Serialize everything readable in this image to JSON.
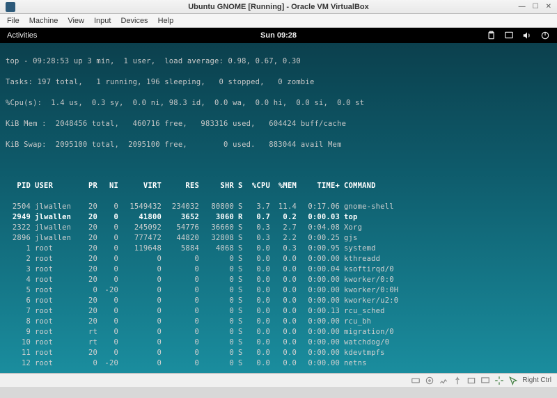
{
  "host": {
    "title": "Ubuntu GNOME [Running] - Oracle VM VirtualBox",
    "menu": [
      "File",
      "Machine",
      "View",
      "Input",
      "Devices",
      "Help"
    ],
    "win_min": "—",
    "win_max": "☐",
    "win_close": "✕",
    "status_hint": "Right Ctrl"
  },
  "gnome": {
    "activities": "Activities",
    "clock": "Sun 09:28"
  },
  "top": {
    "line1": "top - 09:28:53 up 3 min,  1 user,  load average: 0.98, 0.67, 0.30",
    "line2": "Tasks: 197 total,   1 running, 196 sleeping,   0 stopped,   0 zombie",
    "line3": "%Cpu(s):  1.4 us,  0.3 sy,  0.0 ni, 98.3 id,  0.0 wa,  0.0 hi,  0.0 si,  0.0 st",
    "line4": "KiB Mem :  2048456 total,   460716 free,   983316 used,   604424 buff/cache",
    "line5": "KiB Swap:  2095100 total,  2095100 free,        0 used.   883044 avail Mem",
    "cols": [
      "PID",
      "USER",
      "PR",
      "NI",
      "VIRT",
      "RES",
      "SHR",
      "S",
      "%CPU",
      "%MEM",
      "TIME+",
      "COMMAND"
    ],
    "rows": [
      {
        "pid": "2504",
        "user": "jlwallen",
        "pr": "20",
        "ni": "0",
        "virt": "1549432",
        "res": "234032",
        "shr": "80800",
        "s": "S",
        "cpu": "3.7",
        "mem": "11.4",
        "time": "0:17.06",
        "cmd": "gnome-shell",
        "bold": false
      },
      {
        "pid": "2949",
        "user": "jlwallen",
        "pr": "20",
        "ni": "0",
        "virt": "41800",
        "res": "3652",
        "shr": "3060",
        "s": "R",
        "cpu": "0.7",
        "mem": "0.2",
        "time": "0:00.03",
        "cmd": "top",
        "bold": true
      },
      {
        "pid": "2322",
        "user": "jlwallen",
        "pr": "20",
        "ni": "0",
        "virt": "245092",
        "res": "54776",
        "shr": "36660",
        "s": "S",
        "cpu": "0.3",
        "mem": "2.7",
        "time": "0:04.08",
        "cmd": "Xorg",
        "bold": false
      },
      {
        "pid": "2896",
        "user": "jlwallen",
        "pr": "20",
        "ni": "0",
        "virt": "777472",
        "res": "44820",
        "shr": "32808",
        "s": "S",
        "cpu": "0.3",
        "mem": "2.2",
        "time": "0:00.25",
        "cmd": "gjs",
        "bold": false
      },
      {
        "pid": "1",
        "user": "root",
        "pr": "20",
        "ni": "0",
        "virt": "119648",
        "res": "5884",
        "shr": "4068",
        "s": "S",
        "cpu": "0.0",
        "mem": "0.3",
        "time": "0:00.95",
        "cmd": "systemd",
        "bold": false
      },
      {
        "pid": "2",
        "user": "root",
        "pr": "20",
        "ni": "0",
        "virt": "0",
        "res": "0",
        "shr": "0",
        "s": "S",
        "cpu": "0.0",
        "mem": "0.0",
        "time": "0:00.00",
        "cmd": "kthreadd",
        "bold": false
      },
      {
        "pid": "3",
        "user": "root",
        "pr": "20",
        "ni": "0",
        "virt": "0",
        "res": "0",
        "shr": "0",
        "s": "S",
        "cpu": "0.0",
        "mem": "0.0",
        "time": "0:00.04",
        "cmd": "ksoftirqd/0",
        "bold": false
      },
      {
        "pid": "4",
        "user": "root",
        "pr": "20",
        "ni": "0",
        "virt": "0",
        "res": "0",
        "shr": "0",
        "s": "S",
        "cpu": "0.0",
        "mem": "0.0",
        "time": "0:00.00",
        "cmd": "kworker/0:0",
        "bold": false
      },
      {
        "pid": "5",
        "user": "root",
        "pr": "0",
        "ni": "-20",
        "virt": "0",
        "res": "0",
        "shr": "0",
        "s": "S",
        "cpu": "0.0",
        "mem": "0.0",
        "time": "0:00.00",
        "cmd": "kworker/0:0H",
        "bold": false
      },
      {
        "pid": "6",
        "user": "root",
        "pr": "20",
        "ni": "0",
        "virt": "0",
        "res": "0",
        "shr": "0",
        "s": "S",
        "cpu": "0.0",
        "mem": "0.0",
        "time": "0:00.00",
        "cmd": "kworker/u2:0",
        "bold": false
      },
      {
        "pid": "7",
        "user": "root",
        "pr": "20",
        "ni": "0",
        "virt": "0",
        "res": "0",
        "shr": "0",
        "s": "S",
        "cpu": "0.0",
        "mem": "0.0",
        "time": "0:00.13",
        "cmd": "rcu_sched",
        "bold": false
      },
      {
        "pid": "8",
        "user": "root",
        "pr": "20",
        "ni": "0",
        "virt": "0",
        "res": "0",
        "shr": "0",
        "s": "S",
        "cpu": "0.0",
        "mem": "0.0",
        "time": "0:00.00",
        "cmd": "rcu_bh",
        "bold": false
      },
      {
        "pid": "9",
        "user": "root",
        "pr": "rt",
        "ni": "0",
        "virt": "0",
        "res": "0",
        "shr": "0",
        "s": "S",
        "cpu": "0.0",
        "mem": "0.0",
        "time": "0:00.00",
        "cmd": "migration/0",
        "bold": false
      },
      {
        "pid": "10",
        "user": "root",
        "pr": "rt",
        "ni": "0",
        "virt": "0",
        "res": "0",
        "shr": "0",
        "s": "S",
        "cpu": "0.0",
        "mem": "0.0",
        "time": "0:00.00",
        "cmd": "watchdog/0",
        "bold": false
      },
      {
        "pid": "11",
        "user": "root",
        "pr": "20",
        "ni": "0",
        "virt": "0",
        "res": "0",
        "shr": "0",
        "s": "S",
        "cpu": "0.0",
        "mem": "0.0",
        "time": "0:00.00",
        "cmd": "kdevtmpfs",
        "bold": false
      },
      {
        "pid": "12",
        "user": "root",
        "pr": "0",
        "ni": "-20",
        "virt": "0",
        "res": "0",
        "shr": "0",
        "s": "S",
        "cpu": "0.0",
        "mem": "0.0",
        "time": "0:00.00",
        "cmd": "netns",
        "bold": false
      }
    ]
  }
}
